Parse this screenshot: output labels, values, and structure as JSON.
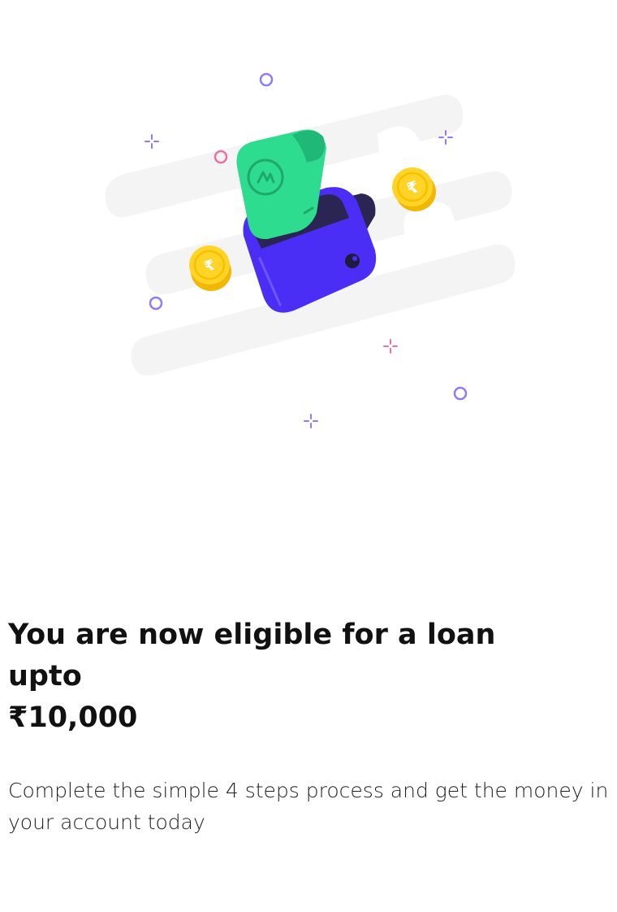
{
  "hero": {
    "illustration": "wallet-with-banknote-and-coins",
    "icons": [
      "wallet-icon",
      "banknote-icon",
      "rupee-coin-icon",
      "sparkle-icon",
      "ring-icon"
    ]
  },
  "eligibility": {
    "headline": "You are now eligible for a loan upto",
    "amount": "₹10,000",
    "description": "Complete the simple 4 steps process and get the money in your account today"
  },
  "colors": {
    "wallet": "#4A2EF5",
    "banknote": "#2EDC8F",
    "coin": "#FFD426",
    "background_stripe": "#F4F4F4",
    "accent_purple": "#7C6BF2",
    "accent_pink": "#F06FA2"
  }
}
